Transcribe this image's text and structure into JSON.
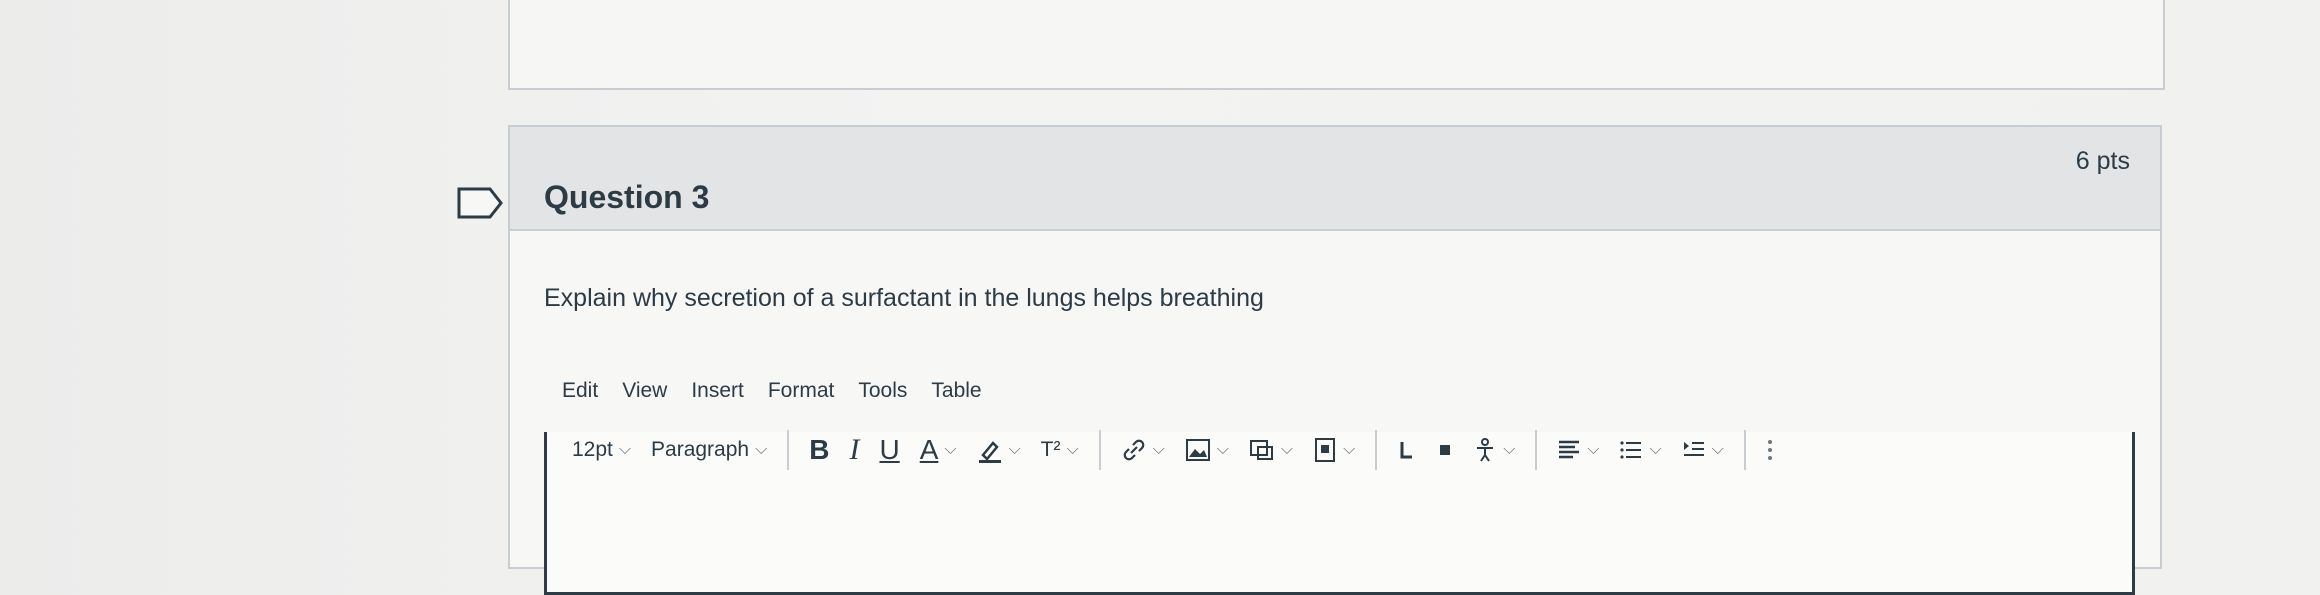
{
  "question": {
    "title": "Question 3",
    "points": "6 pts",
    "text": "Explain why secretion of a surfactant in the lungs helps breathing"
  },
  "editor": {
    "menu": [
      "Edit",
      "View",
      "Insert",
      "Format",
      "Tools",
      "Table"
    ],
    "font_size": "12pt",
    "block_format": "Paragraph",
    "bold_label": "B",
    "italic_label": "I",
    "underline_label": "U",
    "text_color_label": "A",
    "superscript_label": "T²"
  },
  "icons": [
    "flag-icon",
    "chevron-down-icon",
    "highlight-icon",
    "link-icon",
    "image-icon",
    "media-icon",
    "document-icon",
    "equation-icon",
    "embed-icon",
    "accessibility-icon",
    "align-icon",
    "list-icon",
    "indent-icon",
    "more-icon"
  ]
}
